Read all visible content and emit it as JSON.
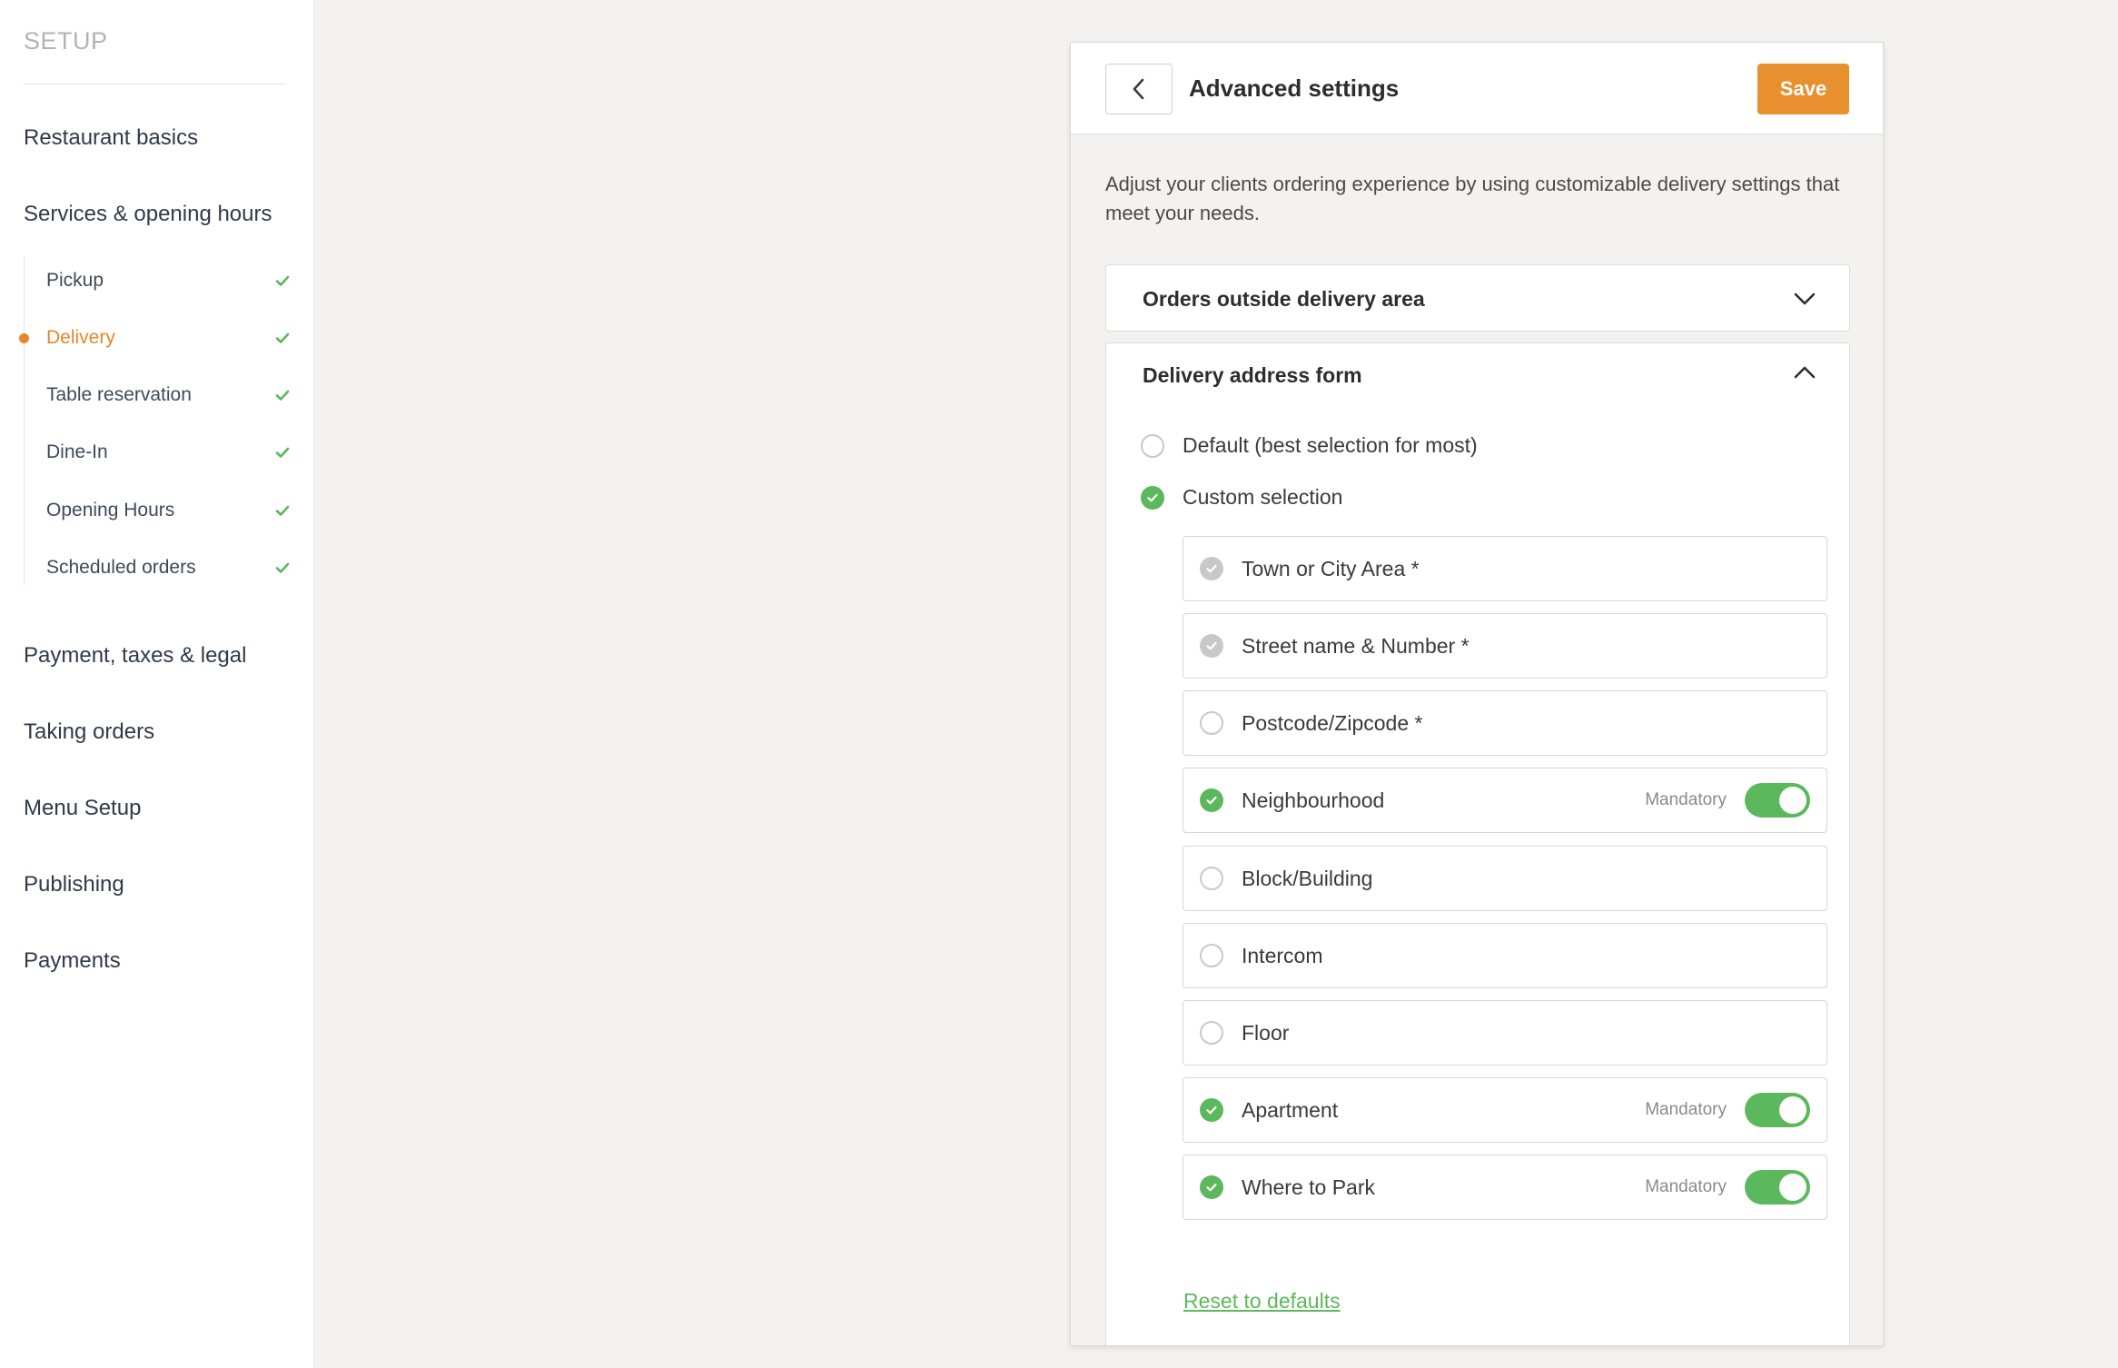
{
  "sidebar": {
    "title": "SETUP",
    "items": [
      {
        "label": "Restaurant basics"
      },
      {
        "label": "Services & opening hours"
      },
      {
        "label": "Payment, taxes & legal"
      },
      {
        "label": "Taking orders"
      },
      {
        "label": "Menu Setup"
      },
      {
        "label": "Publishing"
      },
      {
        "label": "Payments"
      }
    ],
    "subitems": [
      {
        "label": "Pickup",
        "done": true
      },
      {
        "label": "Delivery",
        "done": true,
        "active": true
      },
      {
        "label": "Table reservation",
        "done": true
      },
      {
        "label": "Dine-In",
        "done": true
      },
      {
        "label": "Opening Hours",
        "done": true
      },
      {
        "label": "Scheduled orders",
        "done": true
      }
    ]
  },
  "panel": {
    "title": "Advanced settings",
    "save_label": "Save",
    "description": "Adjust your clients ordering experience by using customizable delivery settings that meet your needs.",
    "sections": {
      "outside_area": {
        "title": "Orders outside delivery area",
        "expanded": false
      },
      "address_form": {
        "title": "Delivery address form",
        "expanded": true,
        "options": [
          {
            "label": "Default (best selection for most)",
            "selected": false
          },
          {
            "label": "Custom selection",
            "selected": true
          }
        ],
        "fields": [
          {
            "label": "Town or City Area *",
            "state": "locked"
          },
          {
            "label": "Street name & Number *",
            "state": "locked"
          },
          {
            "label": "Postcode/Zipcode *",
            "state": "off"
          },
          {
            "label": "Neighbourhood",
            "state": "on",
            "mandatory_label": "Mandatory",
            "mandatory": true
          },
          {
            "label": "Block/Building",
            "state": "off"
          },
          {
            "label": "Intercom",
            "state": "off"
          },
          {
            "label": "Floor",
            "state": "off"
          },
          {
            "label": "Apartment",
            "state": "on",
            "mandatory_label": "Mandatory",
            "mandatory": true
          },
          {
            "label": "Where to Park",
            "state": "on",
            "mandatory_label": "Mandatory",
            "mandatory": true
          }
        ],
        "reset_label": "Reset to defaults"
      }
    }
  },
  "colors": {
    "accent_orange": "#e8852c",
    "save_orange": "#e8902f",
    "success_green": "#5cb85c",
    "background": "#f3f2f0"
  }
}
